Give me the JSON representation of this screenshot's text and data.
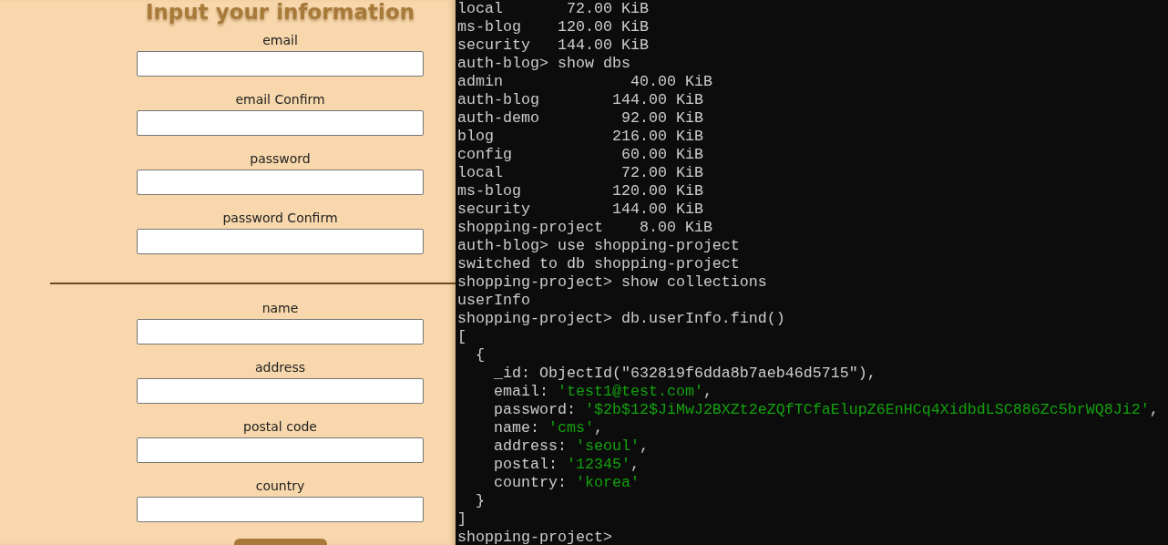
{
  "form": {
    "title": "Input your information",
    "account_fields": [
      {
        "label": "email"
      },
      {
        "label": "email Confirm"
      },
      {
        "label": "password"
      },
      {
        "label": "password Confirm"
      }
    ],
    "profile_fields": [
      {
        "label": "name"
      },
      {
        "label": "address"
      },
      {
        "label": "postal code"
      },
      {
        "label": "country"
      }
    ]
  },
  "terminal": {
    "lines": [
      [
        {
          "kind": "plain",
          "text": "local       72.00 KiB"
        }
      ],
      [
        {
          "kind": "plain",
          "text": "ms-blog    120.00 KiB"
        }
      ],
      [
        {
          "kind": "plain",
          "text": "security   144.00 KiB"
        }
      ],
      [
        {
          "kind": "plain",
          "text": "auth-blog> show dbs"
        }
      ],
      [
        {
          "kind": "plain",
          "text": "admin              40.00 KiB"
        }
      ],
      [
        {
          "kind": "plain",
          "text": "auth-blog        144.00 KiB"
        }
      ],
      [
        {
          "kind": "plain",
          "text": "auth-demo         92.00 KiB"
        }
      ],
      [
        {
          "kind": "plain",
          "text": "blog             216.00 KiB"
        }
      ],
      [
        {
          "kind": "plain",
          "text": "config            60.00 KiB"
        }
      ],
      [
        {
          "kind": "plain",
          "text": "local             72.00 KiB"
        }
      ],
      [
        {
          "kind": "plain",
          "text": "ms-blog          120.00 KiB"
        }
      ],
      [
        {
          "kind": "plain",
          "text": "security         144.00 KiB"
        }
      ],
      [
        {
          "kind": "plain",
          "text": "shopping-project    8.00 KiB"
        }
      ],
      [
        {
          "kind": "plain",
          "text": "auth-blog> use shopping-project"
        }
      ],
      [
        {
          "kind": "plain",
          "text": "switched to db shopping-project"
        }
      ],
      [
        {
          "kind": "plain",
          "text": "shopping-project> show collections"
        }
      ],
      [
        {
          "kind": "plain",
          "text": "userInfo"
        }
      ],
      [
        {
          "kind": "plain",
          "text": "shopping-project> db.userInfo.find()"
        }
      ],
      [
        {
          "kind": "plain",
          "text": "["
        }
      ],
      [
        {
          "kind": "plain",
          "text": "  {"
        }
      ],
      [
        {
          "kind": "plain",
          "text": "    _id: ObjectId(\"632819f6dda8b7aeb46d5715\"),"
        }
      ],
      [
        {
          "kind": "plain",
          "text": "    email: "
        },
        {
          "kind": "string",
          "text": "'test1@test.com'"
        },
        {
          "kind": "plain",
          "text": ","
        }
      ],
      [
        {
          "kind": "plain",
          "text": "    password: "
        },
        {
          "kind": "string",
          "text": "'$2b$12$JiMwJ2BXZt2eZQfTCfaElupZ6EnHCq4XidbdLSC886Zc5brWQ8Ji2'"
        },
        {
          "kind": "plain",
          "text": ","
        }
      ],
      [
        {
          "kind": "plain",
          "text": "    name: "
        },
        {
          "kind": "string",
          "text": "'cms'"
        },
        {
          "kind": "plain",
          "text": ","
        }
      ],
      [
        {
          "kind": "plain",
          "text": "    address: "
        },
        {
          "kind": "string",
          "text": "'seoul'"
        },
        {
          "kind": "plain",
          "text": ","
        }
      ],
      [
        {
          "kind": "plain",
          "text": "    postal: "
        },
        {
          "kind": "string",
          "text": "'12345'"
        },
        {
          "kind": "plain",
          "text": ","
        }
      ],
      [
        {
          "kind": "plain",
          "text": "    country: "
        },
        {
          "kind": "string",
          "text": "'korea'"
        }
      ],
      [
        {
          "kind": "plain",
          "text": "  }"
        }
      ],
      [
        {
          "kind": "plain",
          "text": "]"
        }
      ],
      [
        {
          "kind": "plain",
          "text": "shopping-project>"
        }
      ]
    ]
  }
}
